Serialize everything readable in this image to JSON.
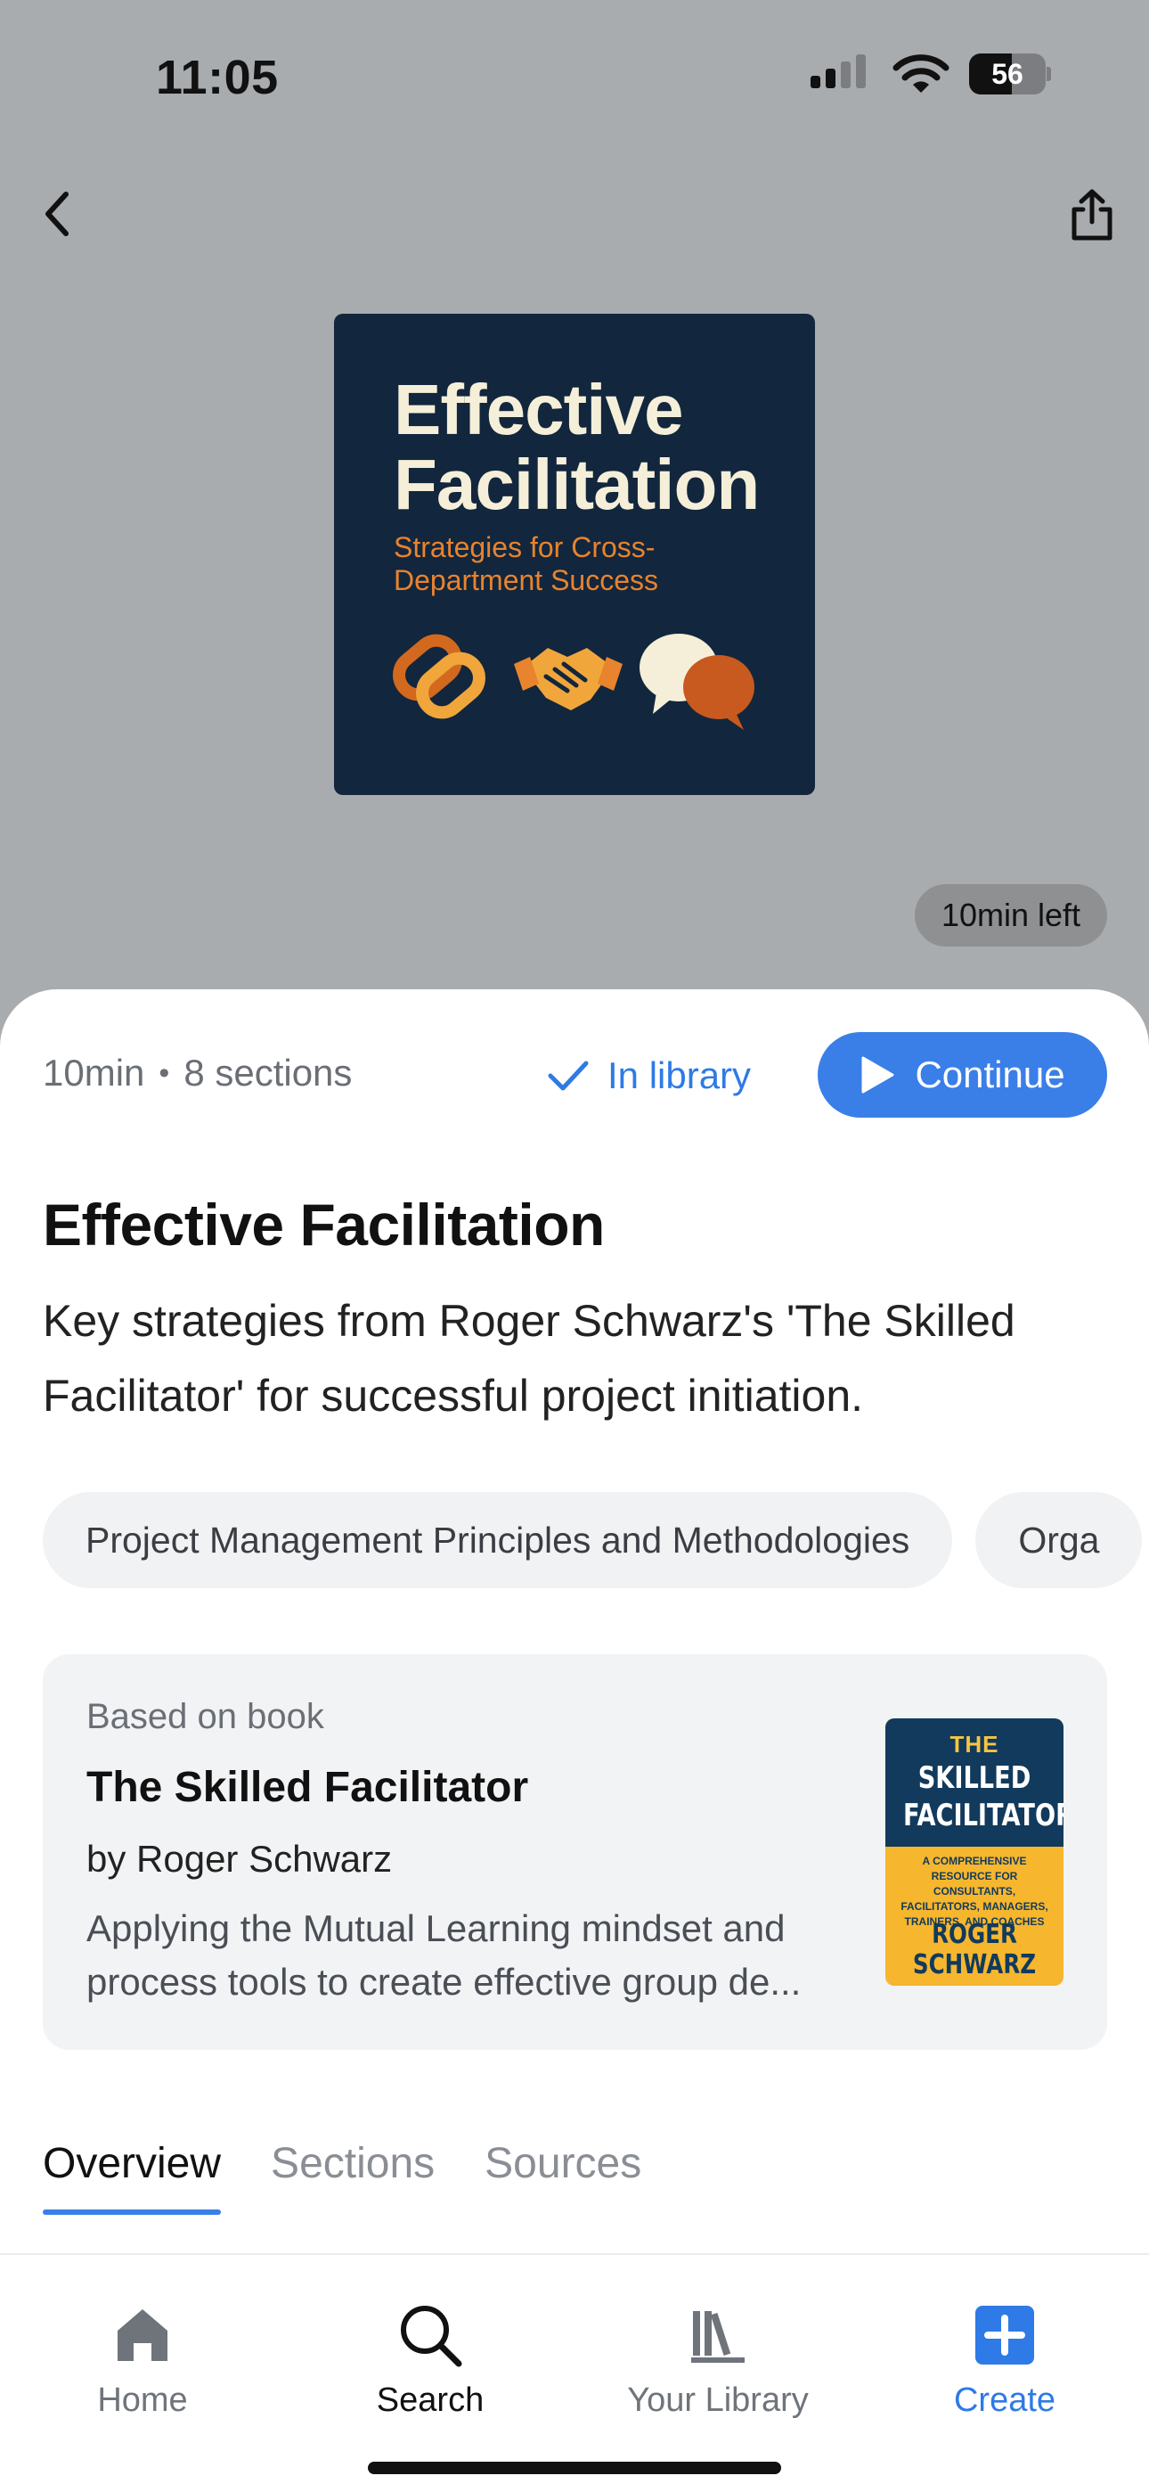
{
  "status_bar": {
    "time": "11:05",
    "battery": "56",
    "battery_level": 0.56
  },
  "hero": {
    "cover": {
      "title": "Effective Facilitation",
      "subtitle": "Strategies for Cross-Department Success"
    },
    "time_left": "10min left"
  },
  "summary": {
    "duration": "10min",
    "sections": "8 sections",
    "in_library_label": "In library",
    "continue_label": "Continue",
    "title": "Effective Facilitation",
    "description": "Key strategies from Roger Schwarz's 'The Skilled Facilitator' for successful project initiation."
  },
  "chips": [
    "Project Management Principles and Methodologies",
    "Orga"
  ],
  "book": {
    "kicker": "Based on book",
    "title": "The Skilled Facilitator",
    "author": "by Roger Schwarz",
    "description_line1": "Applying the Mutual Learning mindset and",
    "description_line2": "process tools to create effective group de...",
    "cover": {
      "the": "THE",
      "main_line1": "SKILLED",
      "main_line2": "FACILITATOR",
      "blurb": "A COMPREHENSIVE RESOURCE FOR CONSULTANTS, FACILITATORS, MANAGERS, TRAINERS, AND COACHES",
      "author_line1": "ROGER",
      "author_line2": "SCHWARZ"
    }
  },
  "tabs": [
    {
      "label": "Overview",
      "active": true
    },
    {
      "label": "Sections",
      "active": false
    },
    {
      "label": "Sources",
      "active": false
    }
  ],
  "tab_bar": {
    "items": [
      {
        "label": "Home",
        "icon": "home-icon",
        "color": "#6f747b"
      },
      {
        "label": "Search",
        "icon": "search-icon",
        "color": "#111111"
      },
      {
        "label": "Your Library",
        "icon": "library-icon",
        "color": "#6f747b"
      },
      {
        "label": "Create",
        "icon": "plus-square-icon",
        "color": "#2e7ae6"
      }
    ]
  },
  "colors": {
    "accent": "#3a7fe8",
    "hero_bg": "#a9acae",
    "cover_bg": "#12263d",
    "cover_orange": "#e8832e"
  }
}
